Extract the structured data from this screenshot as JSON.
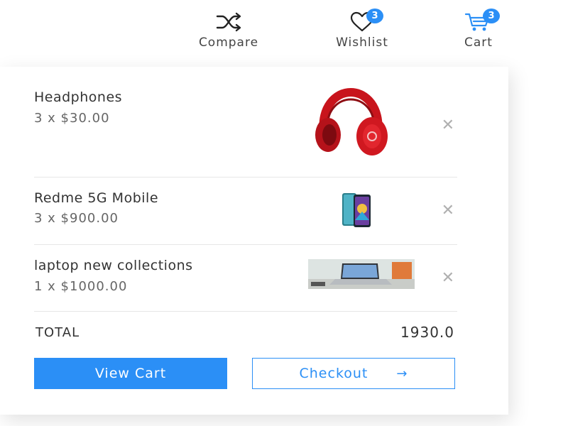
{
  "header": {
    "compare": {
      "label": "Compare",
      "icon": "shuffle-icon"
    },
    "wishlist": {
      "label": "Wishlist",
      "icon": "heart-icon",
      "count": "3"
    },
    "cart": {
      "label": "Cart",
      "icon": "cart-icon",
      "count": "3"
    }
  },
  "cart": {
    "items": [
      {
        "name": "Headphones",
        "qty_price": "3 x $30.00",
        "image": "red-headphones"
      },
      {
        "name": "Redme 5G Mobile",
        "qty_price": "3 x $900.00",
        "image": "smartphone"
      },
      {
        "name": "laptop new collections",
        "qty_price": "1 x $1000.00",
        "image": "laptop"
      }
    ],
    "remove_glyph": "✕",
    "total_label": "TOTAL",
    "total_value": "1930.0",
    "view_cart_label": "View Cart",
    "checkout_label": "Checkout",
    "checkout_arrow": "→"
  },
  "colors": {
    "accent": "#2b8ff6",
    "text": "#333333",
    "muted": "#666666",
    "divider": "#e6e6e6"
  }
}
